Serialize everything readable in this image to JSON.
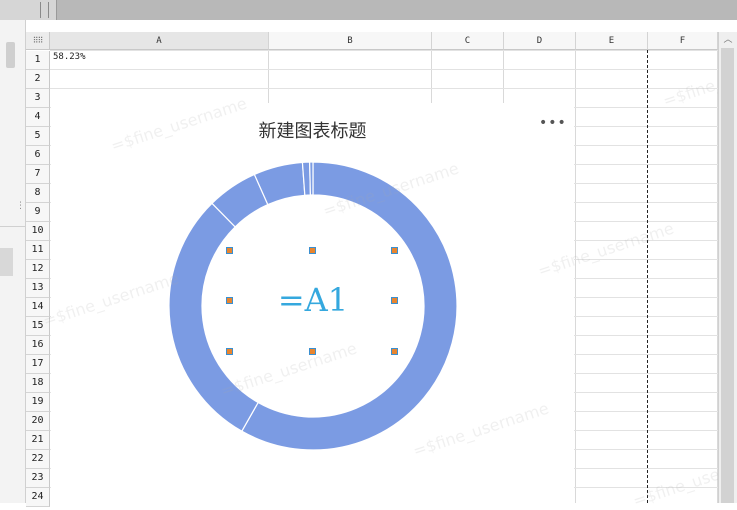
{
  "columns": [
    "A",
    "B",
    "C",
    "D",
    "E",
    "F"
  ],
  "rows": [
    "1",
    "2",
    "3",
    "4",
    "5",
    "6",
    "7",
    "8",
    "9",
    "10",
    "11",
    "12",
    "13",
    "14",
    "15",
    "16",
    "17",
    "18",
    "19",
    "20",
    "21",
    "22",
    "23",
    "24"
  ],
  "cells": {
    "A1": "58.23%"
  },
  "corner_icon": "grid-dots-icon",
  "scroll_up_icon": "chevron-up-icon",
  "chart": {
    "title": "新建图表标题",
    "more_icon": "•••",
    "center_label": "=A1",
    "ring_color": "#7b9be3",
    "label_color": "#35a8de"
  },
  "chart_data": {
    "type": "pie",
    "variant": "donut",
    "values": [
      58.23,
      29.4,
      5.7,
      5.5,
      0.8,
      0.37
    ],
    "color": "#7b9be3",
    "title": "新建图表标题"
  },
  "watermark": "=$fine_username"
}
